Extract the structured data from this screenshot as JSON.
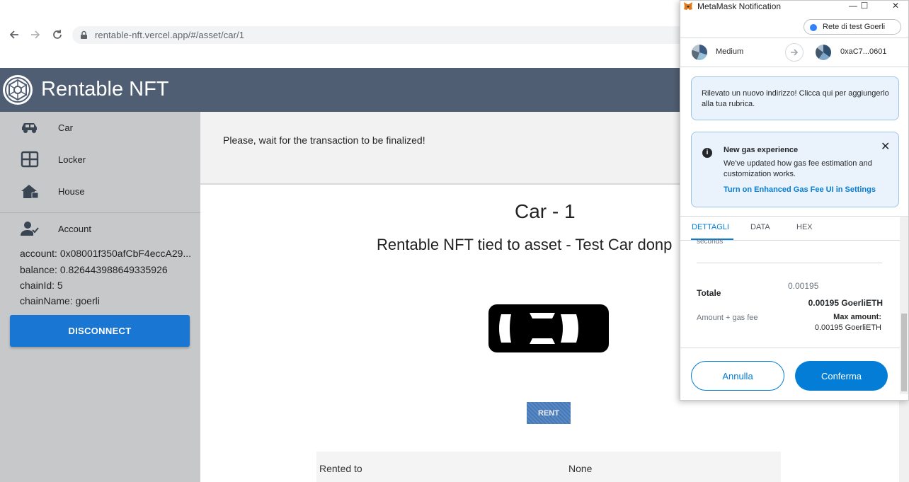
{
  "browser": {
    "url": "rentable-nft.vercel.app/#/asset/car/1"
  },
  "app": {
    "title": "Rentable NFT"
  },
  "sidebar": {
    "items": [
      {
        "label": "Car",
        "icon": "car-icon"
      },
      {
        "label": "Locker",
        "icon": "locker-icon"
      },
      {
        "label": "House",
        "icon": "house-icon"
      }
    ],
    "account": {
      "label": "Account",
      "account_line": "account: 0x08001f350afCbF4eccA29...",
      "balance_line": "balance: 0.826443988649335926",
      "chain_id_line": "chainId: 5",
      "chain_name_line": "chainName: goerli",
      "disconnect_label": "DISCONNECT"
    }
  },
  "main": {
    "notice": "Please, wait for the transaction to be finalized!",
    "asset_title": "Car - 1",
    "asset_subtitle": "Rentable NFT tied to asset - Test Car donp",
    "rent_label": "RENT",
    "rented_to_label": "Rented to",
    "rented_to_value": "None"
  },
  "metamask": {
    "window_title": "MetaMask Notification",
    "network": "Rete di test Goerli",
    "from_account": "Medium",
    "to_address": "0xaC7...0601",
    "new_address_notice": "Rilevato un nuovo indirizzo! Clicca qui per aggiungerlo alla tua rubrica.",
    "gas_title": "New gas experience",
    "gas_body": "We've updated how gas fee estimation and customization works.",
    "gas_link": "Turn on Enhanced Gas Fee UI in Settings",
    "tabs": [
      "DETTAGLI",
      "DATA",
      "HEX"
    ],
    "seconds_text": "seconds",
    "total_label": "Totale",
    "total_small": "0.00195",
    "total_big": "0.00195 GoerliETH",
    "amount_gas_label": "Amount + gas fee",
    "max_amount_label": "Max amount:",
    "max_amount_value": "0.00195 GoerliETH",
    "cancel_label": "Annulla",
    "confirm_label": "Conferma",
    "accent_color": "#037dd6"
  },
  "colors": {
    "header_bg": "#4f5e72",
    "sidebar_bg": "#c6c8ca",
    "disconnect_bg": "#1976d2"
  }
}
